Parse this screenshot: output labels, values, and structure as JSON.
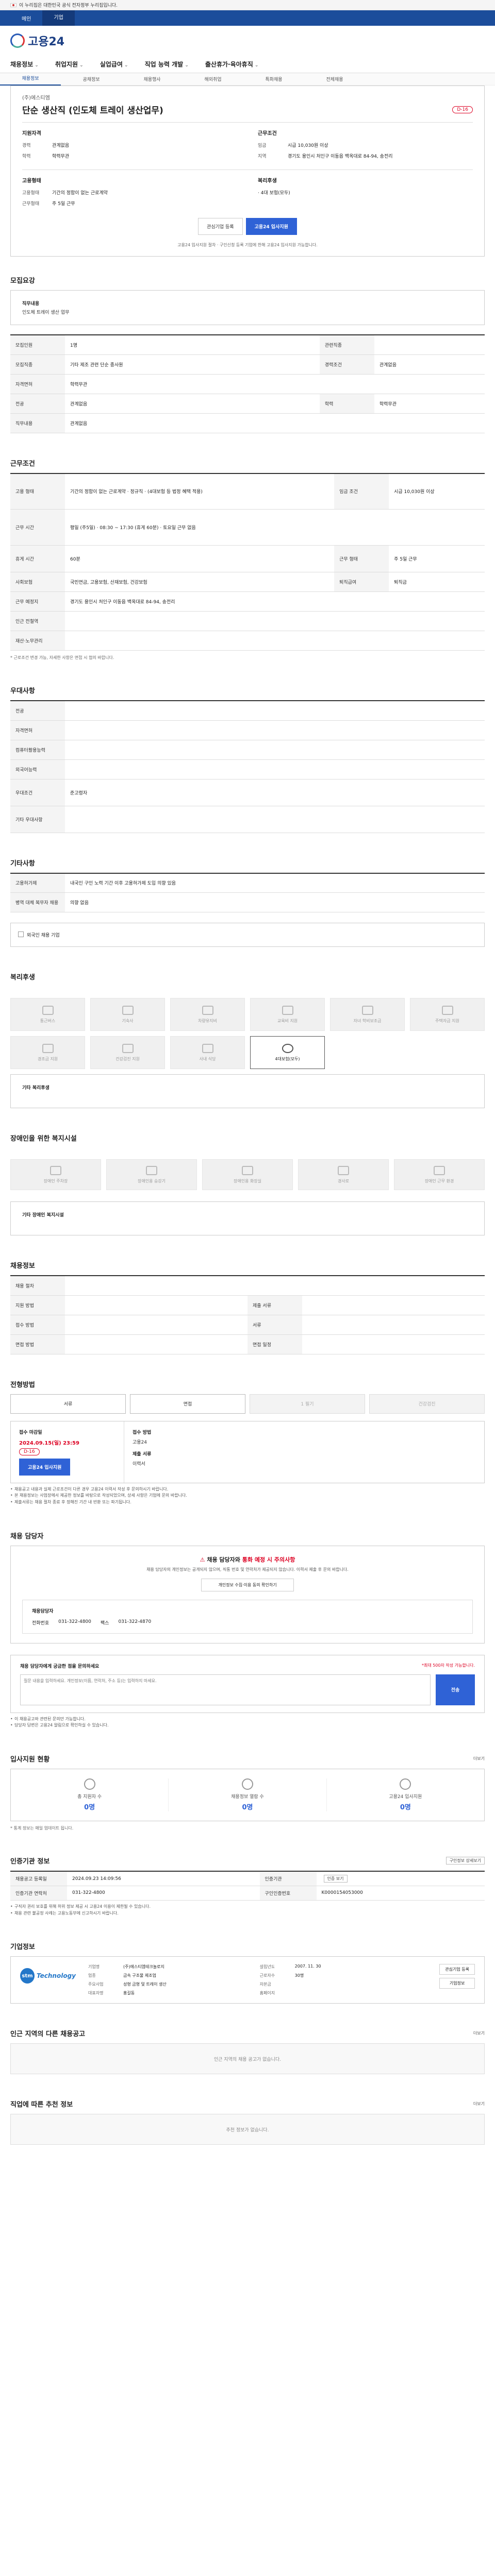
{
  "gov_banner": "이 누리집은 대한민국 공식 전자정부 누리집입니다.",
  "lang_tabs": [
    "메인",
    "기업"
  ],
  "logo_text": "고용24",
  "gnb": [
    "채용정보",
    "취업지원",
    "실업급여",
    "직업 능력 개발",
    "출산휴가·육아휴직"
  ],
  "subnav": [
    "채용정보",
    "공채정보",
    "채용행사",
    "해외취업",
    "특화채용",
    "전체채용"
  ],
  "job": {
    "company": "(주)에스티엠",
    "title": "단순 생산직 (인도체 트레이 생산업무)",
    "dday": "D-16",
    "qual_header": "지원자격",
    "cond_header": "근무조건",
    "qual": [
      {
        "k": "경력",
        "v": "관계없음"
      },
      {
        "k": "학력",
        "v": "학력무관"
      }
    ],
    "cond": [
      {
        "k": "임금",
        "v": "시급 10,030원 이상"
      },
      {
        "k": "지역",
        "v": "경기도 용인시 처인구 이동읍 백옥대로 84-94, 송전리"
      }
    ],
    "emp_header": "고용형태",
    "welfare_header": "복리후생",
    "emp": [
      {
        "k": "고용형태",
        "v": "기간의 정함이 없는 근로계약"
      },
      {
        "k": "근무형태",
        "v": "주 5일 근무"
      }
    ],
    "welfare": "· 4대 보험(모두)",
    "btn_interest": "관심기업 등록",
    "btn_apply": "고용24 입사지원",
    "footnote": "고용24 입사지원 절차 · 구인신청 등록 기업에 한해 고용24 입사지원 가능합니다."
  },
  "s1": {
    "title": "모집요강",
    "job_label": "직무내용",
    "job_value": "인도체 트레이 생산 업무"
  },
  "s1t": [
    {
      "k": "모집직종",
      "v": "그 외 단순 제조 종사원",
      "k2": "관련직종",
      "v2": ""
    },
    {
      "k": "직무내용",
      "v": "기타 제조 관련 단순 종사원",
      "k2": "경력조건",
      "v2": "관계없음"
    },
    {
      "k": "학력",
      "v": "학력무관",
      "k2": "자격면허",
      "v2": ""
    },
    {
      "k": "전공",
      "v": "관계없음",
      "k2": "",
      "v2": ""
    },
    {
      "k": "모집인원",
      "v": "1명",
      "k2": "",
      "v2": ""
    }
  ],
  "s2": {
    "title": "근무조건"
  },
  "s2t": [
    {
      "k": "고용 형태",
      "v": "기간의 정함이 없는 근로계약 · 정규직 · (4대보험 등 법정 혜택 적용)",
      "k2": "임금 조건",
      "v2": "시급 10,030원 이상"
    },
    {
      "k": "근무 시간",
      "v": "평일 (주5일) · 08:30 ~ 17:30 (휴게 60분) · 토요일 근무 없음",
      "k2": "",
      "v2": ""
    },
    {
      "k": "휴게 시간",
      "v": "60분",
      "k2": "근무 형태",
      "v2": "주 5일 근무"
    },
    {
      "k": "사회보험",
      "v": "국민연금, 고용보험, 산재보험, 건강보험",
      "k2": "퇴직급여",
      "v2": "퇴직금"
    },
    {
      "k": "근무 예정지",
      "v": "경기도 용인시 처인구 이동읍 백옥대로 84-94, 송전리",
      "k2": "",
      "v2": ""
    },
    {
      "k": "인근 전철역",
      "v": "",
      "k2": "",
      "v2": ""
    },
    {
      "k": "재산·노무관리",
      "v": "",
      "k2": "",
      "v2": ""
    }
  ],
  "s2_note": "* 근로조건 변경 가능, 자세한 사항은 면접 시 협의 바랍니다.",
  "s3": {
    "title": "우대사항"
  },
  "s3t": [
    {
      "k": "전공",
      "v": ""
    },
    {
      "k": "자격면허",
      "v": ""
    },
    {
      "k": "컴퓨터활용능력",
      "v": ""
    },
    {
      "k": "외국어능력",
      "v": ""
    },
    {
      "k": "우대조건",
      "v": "준고령자"
    },
    {
      "k": "기타 우대사항",
      "v": ""
    }
  ],
  "s4": {
    "title": "기타사항"
  },
  "s4t": [
    {
      "k": "고용허가제",
      "v": "내국인 구인 노력 기간 이후 고용허가제 도입 의향 있음"
    },
    {
      "k": "병역 대체 복무자 채용",
      "v": "의향 없음"
    }
  ],
  "s4_check": "외국인 채용 기업",
  "s5": {
    "title": "복리후생",
    "labels": [
      "통근버스",
      "기숙사",
      "차량유지비",
      "교육비 지원",
      "자녀 학비보조금",
      "주택자금 지원",
      "경조금 지원",
      "건강검진 지원",
      "사내 식당",
      "4대보험(모두)"
    ],
    "etc_label": "기타 복리후생",
    "etc_value": ""
  },
  "s6": {
    "title": "장애인을 위한 복지시설",
    "labels": [
      "장애인 주차장",
      "장애인용 승강기",
      "장애인용 화장실",
      "경사로",
      "장애인 근무 환경"
    ],
    "etc_label": "기타 장애인 복지시설",
    "etc_value": ""
  },
  "s7": {
    "title": "채용정보"
  },
  "s7t": [
    {
      "k": "채용 절차",
      "v": "",
      "k2": "",
      "v2": ""
    },
    {
      "k": "지원 방법",
      "v": "",
      "k2": "제출 서류",
      "v2": ""
    },
    {
      "k": "접수 방법",
      "v": "",
      "k2": "서류",
      "v2": ""
    },
    {
      "k": "면접 방법",
      "v": "",
      "k2": "면접 일정",
      "v2": ""
    }
  ],
  "s8": {
    "title": "전형방법",
    "steps": [
      "서류",
      "면접",
      "1 필기",
      "건강검진"
    ],
    "apply_h": "접수 마감일",
    "apply_date": "2024.09.15(일) 23:59",
    "dday": "D-16",
    "apply_btn": "고용24 입사지원",
    "method_h": "접수 방법",
    "method_v": "고용24",
    "doc_h": "제출 서류",
    "doc_v": "이력서"
  },
  "s8_notes": [
    "채용공고 내용과 실제 근로조건이 다른 경우 고용24 이력서 작성 후 문의하시기 바랍니다.",
    "본 채용정보는 사업장에서 제공한 정보를 바탕으로 작성되었으며, 상세 사항은 기업에 문의 바랍니다.",
    "제출서류는 채용 절차 종료 후 정해진 기간 내 반환 또는 파기됩니다."
  ],
  "contact": {
    "title": "채용 담당자",
    "warn_a": "채용 담당자와 ",
    "warn_b": "통화 예정 시 주의사항",
    "msg": "채용 담당자의 개인정보는 공개되지 않으며, 직통 번호 및 연락처가 제공되지 않습니다. 이력서 제출 후 문의 바랍니다.",
    "cbtn": "개인정보 수집·이용 동의 확인하기",
    "name_label": "채용담당자",
    "phone_label": "전화번호",
    "phone": "031-322-4800",
    "fax_label": "팩스",
    "fax": "031-322-4870"
  },
  "qa": {
    "title": "채용 담당자에게 궁금한 점을 문의하세요",
    "limit": "*최대 500자 작성 가능합니다.",
    "placeholder": "질문 내용을 입력하세요. 개인정보(이름, 연락처, 주소 등)는 입력하지 마세요.",
    "send": "전송"
  },
  "qa_notes": [
    "이 채용공고와 관련된 문의만 가능합니다.",
    "담당자 답변은 고용24 알림으로 확인하실 수 있습니다."
  ],
  "stats": {
    "title": "입사지원 현황",
    "more": "더보기",
    "items": [
      {
        "t": "총 지원자 수",
        "n": "0명"
      },
      {
        "t": "채용정보 열람 수",
        "n": "0명"
      },
      {
        "t": "고용24 입사지원",
        "n": "0명"
      }
    ],
    "note": "* 통계 정보는 매일 업데이트 됩니다."
  },
  "info": {
    "title": "인증기관 정보",
    "btn": "구인정보 상세보기",
    "rows": [
      {
        "h": "채용공고 등록일",
        "v": "2024.09.23 14:09:56",
        "h2": "인증기관",
        "v2": "",
        "tag": "인증 보기"
      },
      {
        "h": "인증기관 연락처",
        "v": "031-322-4800",
        "h2": "구인인증번호",
        "v2": "K0000154053000"
      }
    ],
    "notes": [
      "구직자 권리 보호를 위해 허위 정보 제공 시 고용24 이용이 제한될 수 있습니다.",
      "채용 관련 불공정 사례는 고용노동부에 신고하시기 바랍니다."
    ]
  },
  "company": {
    "title": "기업정보",
    "logo_mark": "stm",
    "logo_name": "Technology",
    "cells": [
      {
        "k": "기업명",
        "v": "(주)에스티엠테크놀로지"
      },
      {
        "k": "설립년도",
        "v": "2007. 11. 30"
      },
      {
        "k": "업종",
        "v": "금속 구조물 제조업"
      },
      {
        "k": "근로자수",
        "v": "30명"
      },
      {
        "k": "주요사업",
        "v": "성형 금형 및 트레이 생산"
      },
      {
        "k": "자본금",
        "v": ""
      },
      {
        "k": "대표자명",
        "v": "홍길동"
      },
      {
        "k": "홈페이지",
        "v": ""
      }
    ],
    "btns": [
      "관심기업 등록",
      "기업정보"
    ]
  },
  "same": {
    "title": "인근 지역의 다른 채용공고",
    "more": "더보기",
    "empty": "인근 지역의 채용 공고가 없습니다."
  },
  "rec": {
    "title": "직업에 따른 추천 정보",
    "more": "더보기",
    "empty": "추천 정보가 없습니다."
  }
}
